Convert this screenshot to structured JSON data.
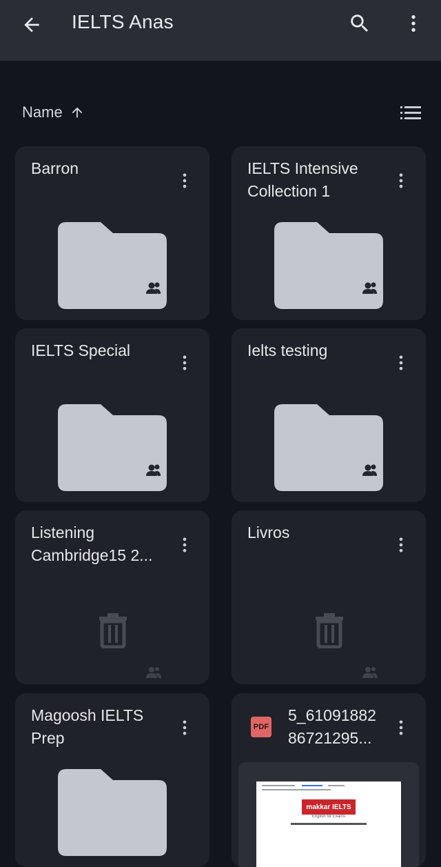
{
  "appbar": {
    "title": "IELTS Anas"
  },
  "sort": {
    "label": "Name"
  },
  "items": [
    {
      "name": "Barron"
    },
    {
      "name": "IELTS Intensive Collection 1"
    },
    {
      "name": "IELTS Special"
    },
    {
      "name": "Ielts testing"
    },
    {
      "name": "Listening Cambridge15 2..."
    },
    {
      "name": "Livros"
    },
    {
      "name": "Magoosh IELTS Prep"
    },
    {
      "name_line1": "5_61091882",
      "name_line2": "86721295...",
      "badge": "PDF"
    }
  ],
  "thumbnail": {
    "logo_text": "makkar IELTS",
    "logo_sub": "English for Exams"
  },
  "colors": {
    "folder": "#c4c7ce",
    "card": "#1f2228",
    "appbar": "#2a2d34",
    "background": "#12151c",
    "pdf": "#e06666"
  }
}
